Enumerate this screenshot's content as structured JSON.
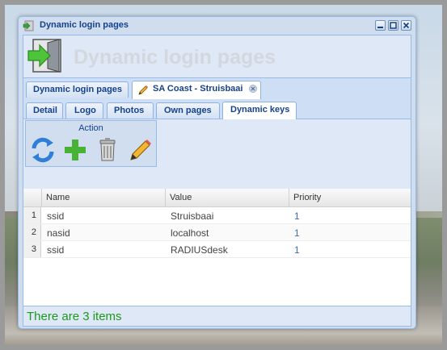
{
  "window": {
    "title": "Dynamic login pages"
  },
  "header": {
    "heading": "Dynamic login pages"
  },
  "main_tabs": [
    {
      "label": "Dynamic login pages",
      "active": false
    },
    {
      "label": "SA Coast - Struisbaai",
      "active": true,
      "closable": true
    }
  ],
  "sub_tabs": [
    {
      "label": "Detail"
    },
    {
      "label": "Logo"
    },
    {
      "label": "Photos"
    },
    {
      "label": "Own pages"
    },
    {
      "label": "Dynamic keys",
      "active": true
    }
  ],
  "toolbar": {
    "group_title": "Action",
    "buttons": [
      "refresh-icon",
      "add-icon",
      "delete-icon",
      "edit-icon"
    ]
  },
  "grid": {
    "columns": [
      "Name",
      "Value",
      "Priority"
    ],
    "rows": [
      {
        "index": "1",
        "name": "ssid",
        "value": "Struisbaai",
        "priority": "1"
      },
      {
        "index": "2",
        "name": "nasid",
        "value": "localhost",
        "priority": "1"
      },
      {
        "index": "3",
        "name": "ssid",
        "value": "RADIUSdesk",
        "priority": "1"
      }
    ]
  },
  "status": {
    "text": "There are 3 items",
    "color": "#1a9a1a"
  },
  "colors": {
    "accent": "#15428b",
    "tab_border": "#99bbe8",
    "panel_bg": "#dfe8f6"
  }
}
